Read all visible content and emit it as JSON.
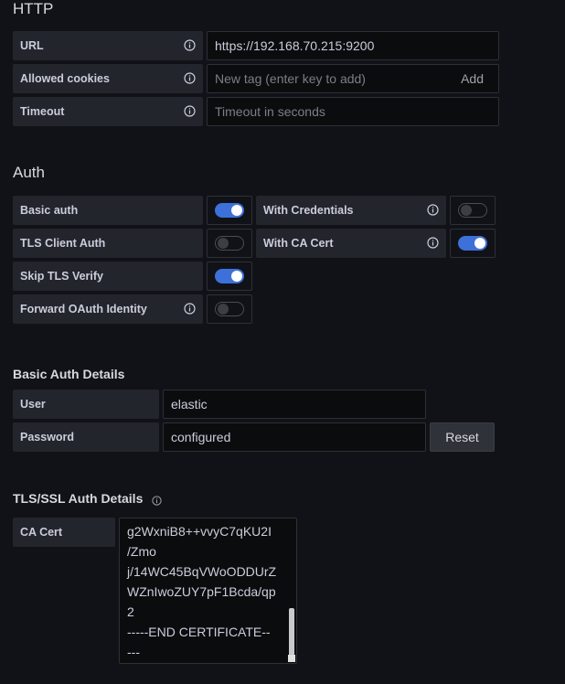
{
  "http": {
    "heading": "HTTP",
    "url_label": "URL",
    "url_value": "https://192.168.70.215:9200",
    "cookies_label": "Allowed cookies",
    "cookies_placeholder": "New tag (enter key to add)",
    "cookies_add": "Add",
    "timeout_label": "Timeout",
    "timeout_placeholder": "Timeout in seconds"
  },
  "auth": {
    "heading": "Auth",
    "basic_auth_label": "Basic auth",
    "basic_auth_on": true,
    "with_credentials_label": "With Credentials",
    "with_credentials_on": false,
    "tls_client_auth_label": "TLS Client Auth",
    "tls_client_auth_on": false,
    "with_ca_cert_label": "With CA Cert",
    "with_ca_cert_on": true,
    "skip_tls_label": "Skip TLS Verify",
    "skip_tls_on": true,
    "forward_oauth_label": "Forward OAuth Identity",
    "forward_oauth_on": false
  },
  "basic_auth_details": {
    "heading": "Basic Auth Details",
    "user_label": "User",
    "user_value": "elastic",
    "password_label": "Password",
    "password_value": "configured",
    "reset_label": "Reset"
  },
  "tls_details": {
    "heading": "TLS/SSL Auth Details",
    "ca_cert_label": "CA Cert",
    "ca_cert_lines": [
      "g2WxniB8++vvyC7qKU2I",
      "/Zmo",
      "j/14WC45BqVWoODDUrZ",
      "WZnIwoZUY7pF1Bcda/qp",
      "2",
      "-----END CERTIFICATE--",
      "---"
    ]
  },
  "colors": {
    "accent": "#3d71d9",
    "background": "#111217",
    "label_bg": "#22252b"
  }
}
